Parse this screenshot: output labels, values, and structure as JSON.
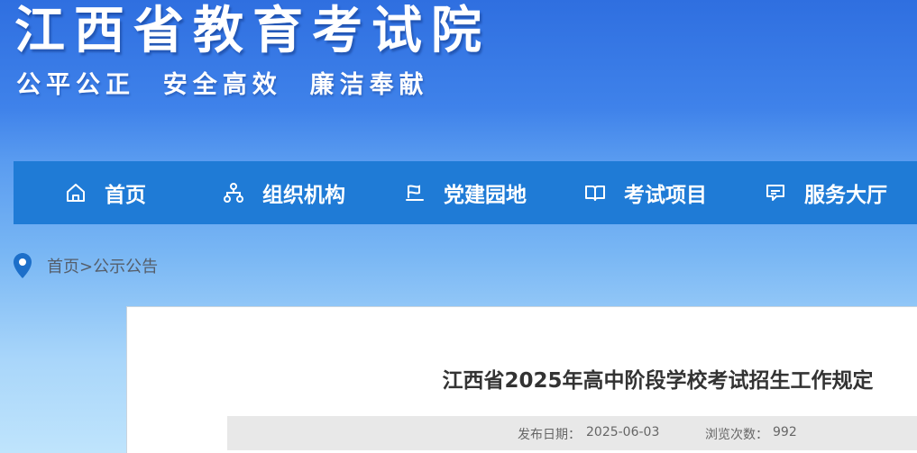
{
  "header": {
    "title": "江西省教育考试院",
    "slogan": "公平公正  安全高效  廉洁奉献"
  },
  "nav": {
    "items": [
      {
        "label": "首页",
        "icon": "home-icon"
      },
      {
        "label": "组织机构",
        "icon": "org-chart-icon"
      },
      {
        "label": "党建园地",
        "icon": "party-emblem-icon"
      },
      {
        "label": "考试项目",
        "icon": "open-book-icon"
      },
      {
        "label": "服务大厅",
        "icon": "chat-bubble-icon"
      }
    ]
  },
  "breadcrumb": {
    "home": "首页",
    "separator": ">",
    "current": "公示公告"
  },
  "article": {
    "title": "江西省2025年高中阶段学校考试招生工作规定",
    "publish_label": "发布日期：",
    "publish_date": "2025-06-03",
    "views_label": "浏览次数：",
    "views": "992"
  },
  "colors": {
    "nav_bg": "#1f7bd6",
    "title_text": "#333333",
    "meta_bg": "#e8e8e8",
    "location_pin": "#1d6fc9"
  }
}
